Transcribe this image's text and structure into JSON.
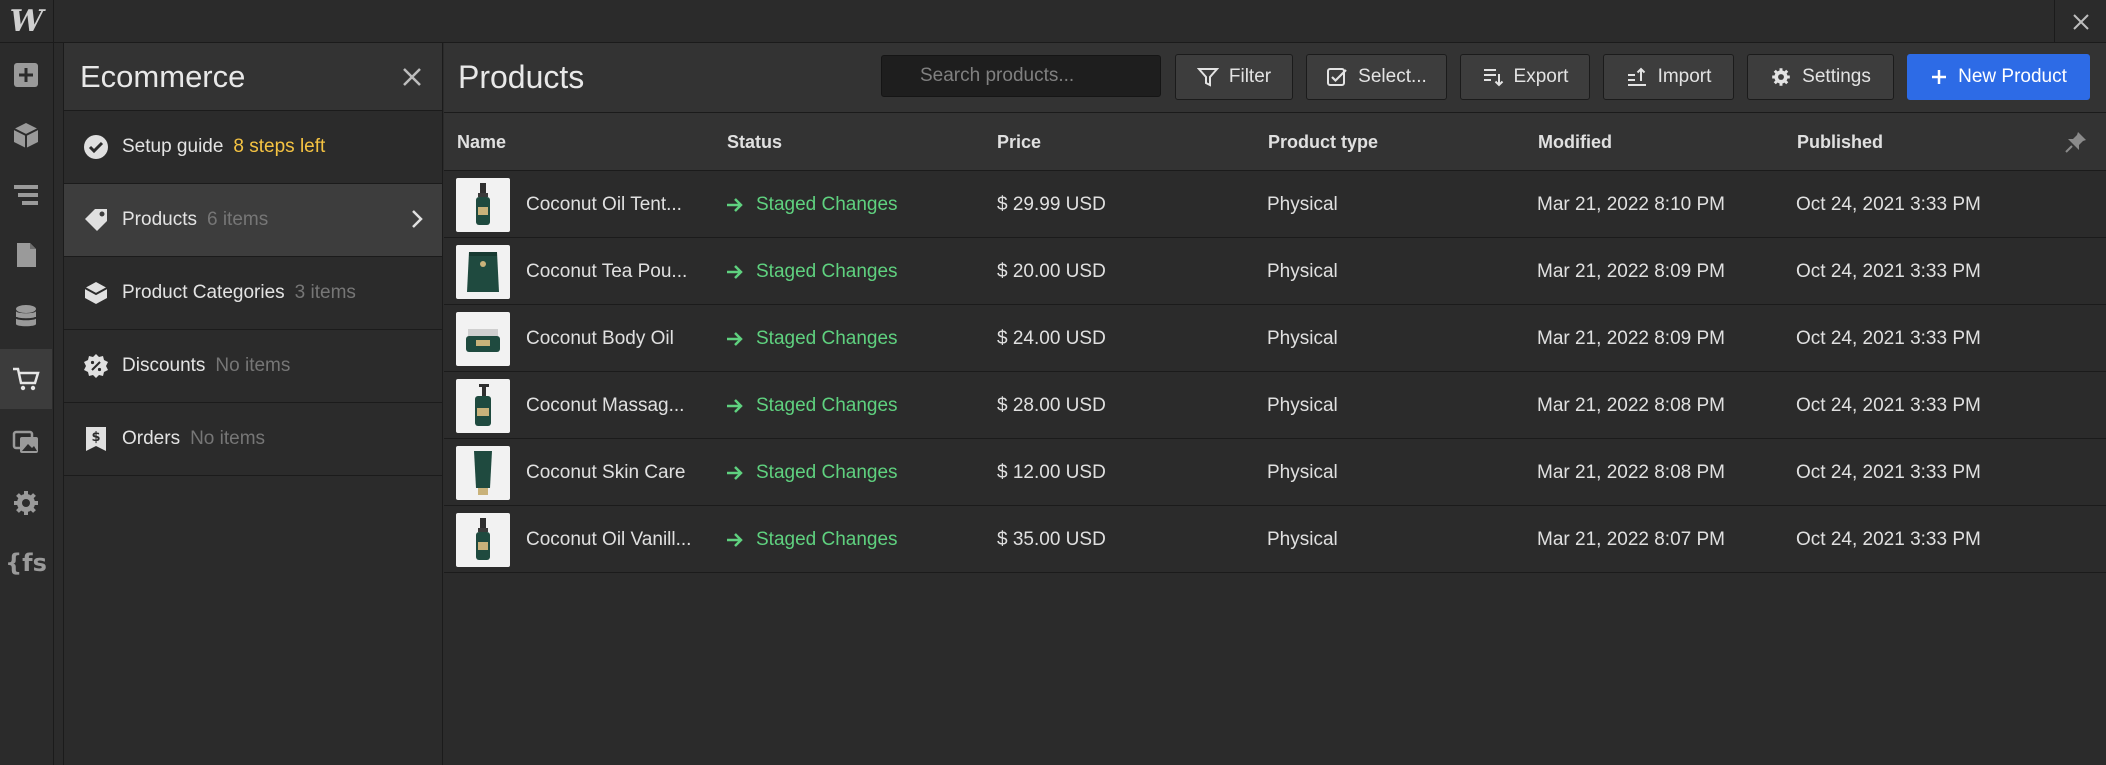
{
  "app": {
    "logo": "W"
  },
  "panel": {
    "title": "Ecommerce",
    "items": [
      {
        "label": "Setup guide",
        "count": "8 steps left"
      },
      {
        "label": "Products",
        "count": "6 items"
      },
      {
        "label": "Product Categories",
        "count": "3 items"
      },
      {
        "label": "Discounts",
        "count": "No items"
      },
      {
        "label": "Orders",
        "count": "No items"
      }
    ]
  },
  "main": {
    "title": "Products",
    "search": {
      "placeholder": "Search products..."
    },
    "toolbar": {
      "filter": "Filter",
      "select": "Select...",
      "export": "Export",
      "import": "Import",
      "settings": "Settings",
      "new_product": "New Product"
    },
    "columns": [
      "Name",
      "Status",
      "Price",
      "Product type",
      "Modified",
      "Published"
    ],
    "rows": [
      {
        "name": "Coconut Oil Tent...",
        "status": "Staged Changes",
        "price": "$ 29.99 USD",
        "type": "Physical",
        "modified": "Mar 21, 2022 8:10 PM",
        "published": "Oct 24, 2021 3:33 PM"
      },
      {
        "name": "Coconut Tea Pou...",
        "status": "Staged Changes",
        "price": "$ 20.00 USD",
        "type": "Physical",
        "modified": "Mar 21, 2022 8:09 PM",
        "published": "Oct 24, 2021 3:33 PM"
      },
      {
        "name": "Coconut Body Oil",
        "status": "Staged Changes",
        "price": "$ 24.00 USD",
        "type": "Physical",
        "modified": "Mar 21, 2022 8:09 PM",
        "published": "Oct 24, 2021 3:33 PM"
      },
      {
        "name": "Coconut Massag...",
        "status": "Staged Changes",
        "price": "$ 28.00 USD",
        "type": "Physical",
        "modified": "Mar 21, 2022 8:08 PM",
        "published": "Oct 24, 2021 3:33 PM"
      },
      {
        "name": "Coconut Skin Care",
        "status": "Staged Changes",
        "price": "$ 12.00 USD",
        "type": "Physical",
        "modified": "Mar 21, 2022 8:08 PM",
        "published": "Oct 24, 2021 3:33 PM"
      },
      {
        "name": "Coconut Oil Vanill...",
        "status": "Staged Changes",
        "price": "$ 35.00 USD",
        "type": "Physical",
        "modified": "Mar 21, 2022 8:07 PM",
        "published": "Oct 24, 2021 3:33 PM"
      }
    ]
  },
  "colors": {
    "accent": "#2d6be6",
    "staged": "#5fd17f",
    "warning": "#f5c342"
  }
}
